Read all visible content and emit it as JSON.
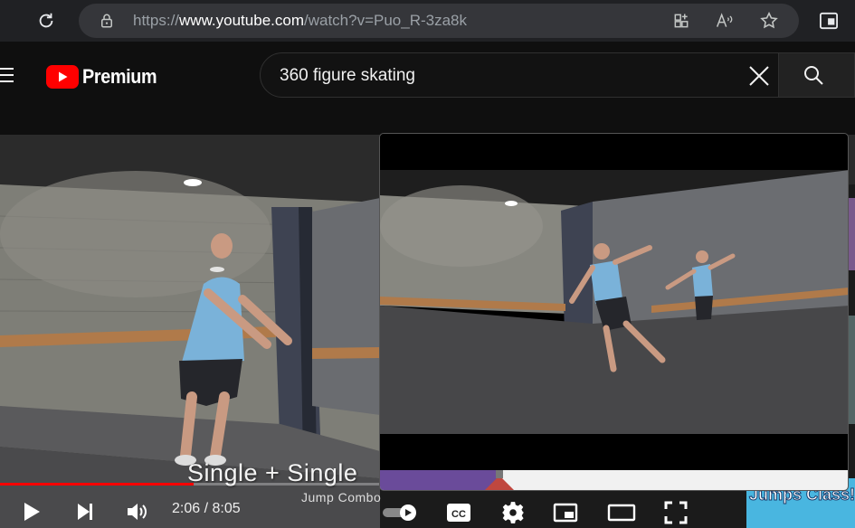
{
  "browser": {
    "url_scheme": "https://",
    "url_domain": "www.youtube.com",
    "url_path": "/watch?v=Puo_R-3za8k",
    "icons": [
      "refresh-icon",
      "lock-icon",
      "extensions-icon",
      "read-aloud-icon",
      "favorite-star-icon",
      "tab-actions-icon"
    ]
  },
  "masthead": {
    "logo_text": "Premium",
    "search_query": "360 figure skating",
    "icons": [
      "menu-icon",
      "youtube-play-logo",
      "clear-search-icon",
      "search-icon"
    ]
  },
  "player": {
    "caption_title": "Single + Single",
    "caption_subtitle": "Jump Combo",
    "current_time": "2:06",
    "duration": "8:05",
    "time_display": "2:06 / 8:05",
    "progress_fraction": 0.259,
    "autoplay_on": true,
    "icons": [
      "play-icon",
      "next-icon",
      "volume-icon",
      "autoplay-toggle",
      "captions-icon",
      "settings-gear-icon",
      "miniplayer-icon",
      "theater-mode-icon",
      "fullscreen-icon"
    ]
  },
  "popup_preview": {
    "played_fraction": 0.254,
    "scrubber_fraction": 0.254
  },
  "sidebar": {
    "thumb_text": "Jumps Class!"
  },
  "colors": {
    "youtube_red": "#ff0000",
    "background": "#0f0f0f",
    "popup_progress_played": "#6a4b9a"
  }
}
